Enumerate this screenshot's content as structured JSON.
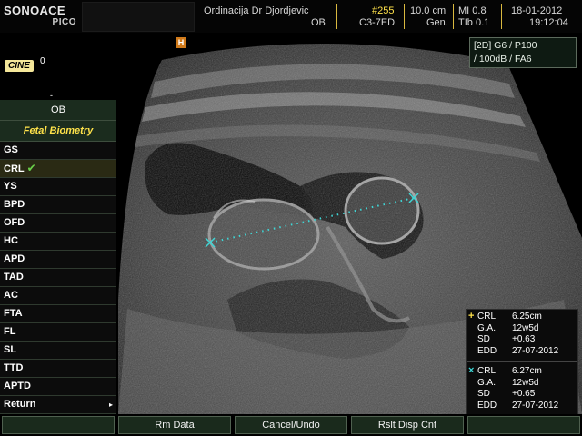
{
  "header": {
    "brand": "SONOACE",
    "model": "PICO",
    "clinic": "Ordinacija Dr Djordjevic",
    "exam": "OB",
    "image_number": "#255",
    "probe": "C3-7ED",
    "depth": "10.0 cm",
    "mode_gen": "Gen.",
    "mi": "MI  0.8",
    "tib": "TIb  0.1",
    "date": "18-01-2012",
    "time": "19:12:04"
  },
  "cine_label": "CINE",
  "cine_value": "0",
  "side_tick": "-",
  "probe_icon": "H",
  "image_params": {
    "line1": "[2D] G6 / P100",
    "line2": "/ 100dB / FA6"
  },
  "menu": {
    "title": "OB",
    "subtitle": "Fetal Biometry",
    "items": [
      {
        "label": "GS"
      },
      {
        "label": "CRL",
        "selected": true,
        "check": "✔"
      },
      {
        "label": "YS"
      },
      {
        "label": "BPD"
      },
      {
        "label": "OFD"
      },
      {
        "label": "HC"
      },
      {
        "label": "APD"
      },
      {
        "label": "TAD"
      },
      {
        "label": "AC"
      },
      {
        "label": "FTA"
      },
      {
        "label": "FL"
      },
      {
        "label": "SL"
      },
      {
        "label": "TTD"
      },
      {
        "label": "APTD"
      },
      {
        "label": "Return",
        "arrow": "▸"
      }
    ]
  },
  "results": [
    {
      "marker": "+",
      "marker_color": "#ffe24a",
      "rows": [
        {
          "label": "CRL",
          "value": "6.25cm"
        },
        {
          "label": "G.A.",
          "value": "12w5d"
        },
        {
          "label": "SD",
          "value": "+0.63"
        },
        {
          "label": "EDD",
          "value": "27-07-2012"
        }
      ]
    },
    {
      "marker": "×",
      "marker_color": "#3fd6d6",
      "rows": [
        {
          "label": "CRL",
          "value": "6.27cm"
        },
        {
          "label": "G.A.",
          "value": "12w5d"
        },
        {
          "label": "SD",
          "value": "+0.65"
        },
        {
          "label": "EDD",
          "value": "27-07-2012"
        }
      ]
    }
  ],
  "softkeys": [
    "",
    "Rm Data",
    "Cancel/Undo",
    "Rslt Disp Cnt",
    ""
  ],
  "colors": {
    "accent_yellow": "#ffe24a",
    "caliper_cyan": "#3fd6d6",
    "menu_green": "#1b2c1e",
    "check_green": "#6ad14a"
  }
}
